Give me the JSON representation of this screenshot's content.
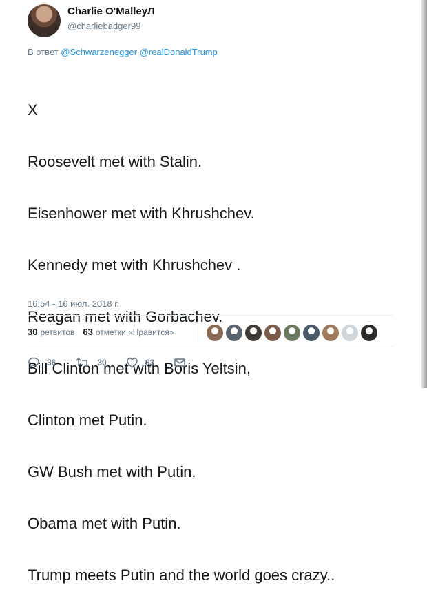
{
  "author": {
    "display_name": "Charlie O'MalleyЛ",
    "handle": "@charliebadger99"
  },
  "reply": {
    "prefix": "В ответ",
    "mentions": [
      "@Schwarzenegger",
      "@realDonaldTrump"
    ]
  },
  "tweet_lines": [
    "X",
    "Roosevelt met with Stalin.",
    "Eisenhower met with Khrushchev.",
    "Kennedy met with Khrushchev .",
    "Reagan met with Gorbachev.",
    "Bill Clinton met with Boris Yeltsin,",
    "Clinton met Putin.",
    "GW Bush met with Putin.",
    "Obama met with Putin.",
    "Trump meets Putin and the world goes crazy.."
  ],
  "timestamp": "16:54 - 16 июл. 2018 г.",
  "stats": {
    "retweets_count": "30",
    "retweets_label": "ретвитов",
    "likes_count": "63",
    "likes_label": "отметки «Нравится»"
  },
  "liker_avatars": [
    "#8a6a55",
    "#5a6470",
    "#3f3a36",
    "#7a5a48",
    "#6b7a60",
    "#4a5a6a",
    "#a07858",
    "#cfd6dc",
    "#2b2b2b"
  ],
  "actions": {
    "reply_count": "36",
    "retweet_count": "30",
    "like_count": "63"
  },
  "colors": {
    "link": "#1b95e0",
    "muted": "#657786",
    "text": "#14171a"
  }
}
